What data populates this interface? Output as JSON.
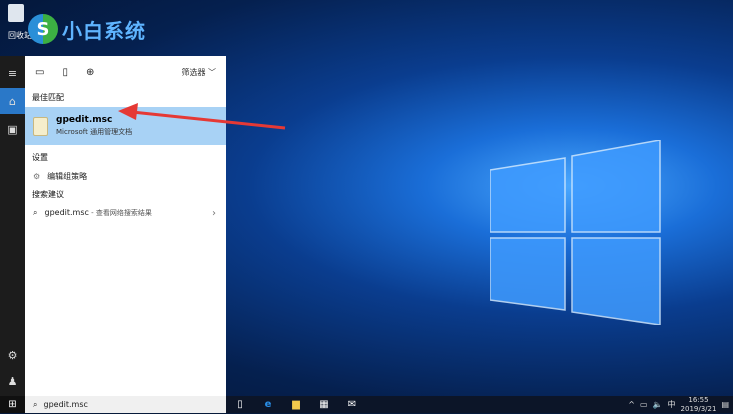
{
  "desktop": {
    "logo_text": "小白系统",
    "recycle_label": "回收站"
  },
  "panel": {
    "filter_label": "筛选器",
    "best_match_heading": "最佳匹配",
    "best_match": {
      "title": "gpedit.msc",
      "subtitle": "Microsoft 通用管理文档"
    },
    "settings_heading": "设置",
    "settings_item": "编辑组策略",
    "suggest_heading": "搜索建议",
    "suggest_item": {
      "query": "gpedit.msc",
      "sub": " - 查看网络搜索结果"
    }
  },
  "search": {
    "value": "gpedit.msc"
  },
  "tray": {
    "time": "16:55",
    "date": "2019/3/21",
    "ime": "中"
  },
  "colors": {
    "selected": "#a8d2f5",
    "arrow": "#e53935"
  }
}
